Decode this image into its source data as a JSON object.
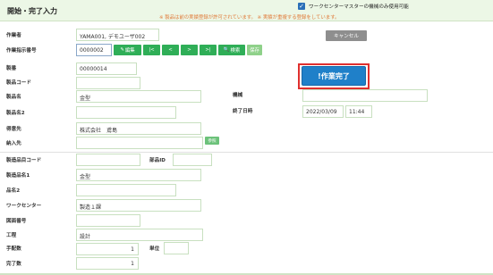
{
  "header": {
    "title": "開始・完了入力",
    "checkbox_label": "ワークセンターマスターの機械のみ使用可能",
    "checkbox_mark": "✓",
    "warning": "※ 製品は前の実績登録が許可されています。 ※ 実績が重複する登録をしています。"
  },
  "form": {
    "worker_label": "作業者",
    "worker_value": "YAMA001, デモユーザ002",
    "order_label": "作業指示番号",
    "order_value": "0000002",
    "order_buttons": {
      "edit": "編集",
      "edit_icon": "✎",
      "first": "|<",
      "prev": "<",
      "next": ">",
      "last": ">|",
      "search": "検索",
      "search_icon": "🔍",
      "hold": "保存"
    },
    "cancel_label": "キャンセル",
    "complete_label": "!作業完了",
    "product_label": "製番",
    "product_value": "00000014",
    "product_code_label": "製品コード",
    "product_code_value": "",
    "product_name_label": "製品名",
    "product_name_value": "金型",
    "product_name2_label": "製品名2",
    "product_name2_value": "",
    "customer_label": "得意先",
    "customer_value": "株式会社　鳶島",
    "delivery_label": "納入先",
    "delivery_value": "",
    "ref_label": "参照",
    "machine_label": "機械",
    "machine_value": "",
    "end_datetime_label": "終了日時",
    "end_date_value": "2022/03/09",
    "end_time_value": "11:44",
    "mfg_item_code_label": "製造品目コード",
    "mfg_item_code_value": "",
    "part_id_label": "部品ID",
    "part_id_value": "",
    "mfg_item_name1_label": "製造品名1",
    "mfg_item_name1_value": "金型",
    "item_name2_label": "品名2",
    "item_name2_value": "",
    "workcenter_label": "ワークセンター",
    "workcenter_value": "製造１課",
    "drawing_label": "図面番号",
    "drawing_value": "",
    "process_label": "工程",
    "process_value": "設計",
    "planned_qty_label": "手配数",
    "planned_qty_value": "1",
    "unit_label": "単位",
    "unit_value": "",
    "completed_qty_label": "完了数",
    "completed_qty_value": "1"
  }
}
